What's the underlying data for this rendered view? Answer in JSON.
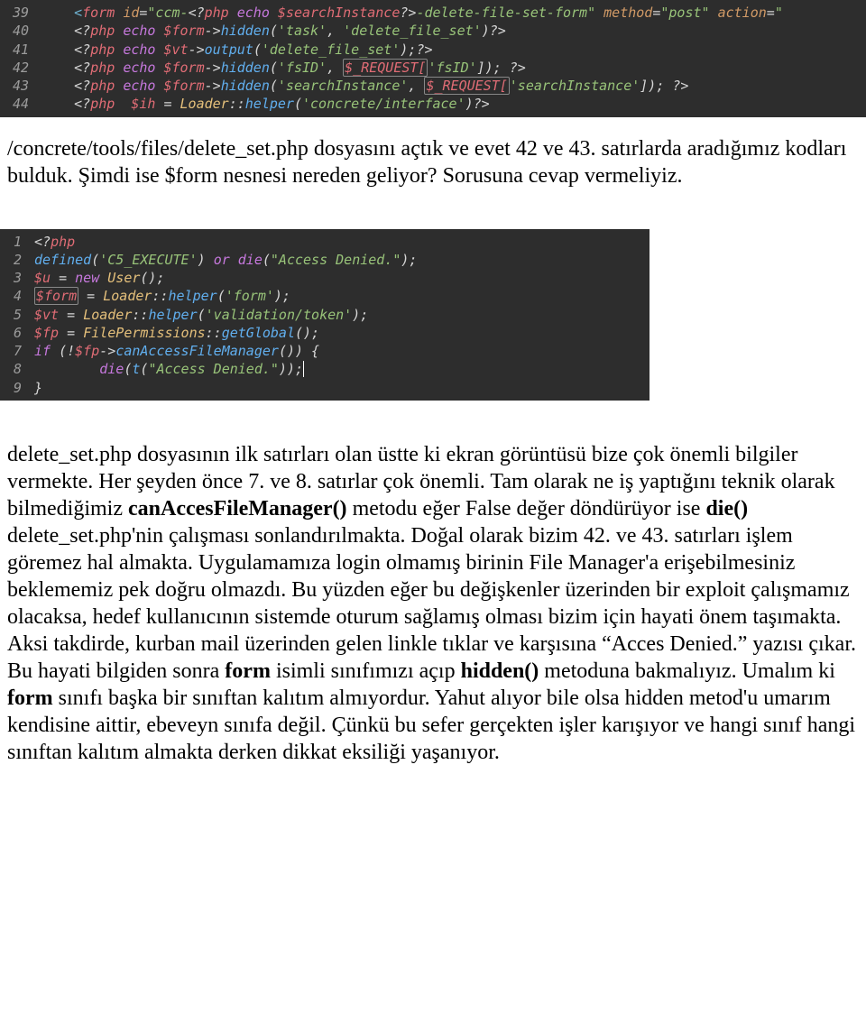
{
  "code1": {
    "lines": [
      {
        "n": "39",
        "tokens": [
          {
            "t": "    ",
            "c": "c-default"
          },
          {
            "t": "<",
            "c": "c-tag"
          },
          {
            "t": "form ",
            "c": "c-red"
          },
          {
            "t": "id",
            "c": "c-orange"
          },
          {
            "t": "=",
            "c": "c-white"
          },
          {
            "t": "\"ccm-",
            "c": "c-green"
          },
          {
            "t": "<?",
            "c": "c-default"
          },
          {
            "t": "php ",
            "c": "c-red"
          },
          {
            "t": "echo ",
            "c": "c-purple"
          },
          {
            "t": "$searchInstance",
            "c": "c-red"
          },
          {
            "t": "?>",
            "c": "c-default"
          },
          {
            "t": "-delete-file-set-form\"",
            "c": "c-green"
          },
          {
            "t": " ",
            "c": "c-default"
          },
          {
            "t": "method",
            "c": "c-orange"
          },
          {
            "t": "=",
            "c": "c-white"
          },
          {
            "t": "\"post\"",
            "c": "c-green"
          },
          {
            "t": " ",
            "c": "c-default"
          },
          {
            "t": "action",
            "c": "c-orange"
          },
          {
            "t": "=",
            "c": "c-white"
          },
          {
            "t": "\"",
            "c": "c-green"
          }
        ]
      },
      {
        "n": "40",
        "tokens": [
          {
            "t": "    ",
            "c": "c-default"
          },
          {
            "t": "<?",
            "c": "c-default"
          },
          {
            "t": "php ",
            "c": "c-red"
          },
          {
            "t": "echo ",
            "c": "c-purple"
          },
          {
            "t": "$form",
            "c": "c-red"
          },
          {
            "t": "->",
            "c": "c-white"
          },
          {
            "t": "hidden",
            "c": "c-blue"
          },
          {
            "t": "(",
            "c": "c-white"
          },
          {
            "t": "'task'",
            "c": "c-green"
          },
          {
            "t": ", ",
            "c": "c-white"
          },
          {
            "t": "'delete_file_set'",
            "c": "c-green"
          },
          {
            "t": ")",
            "c": "c-white"
          },
          {
            "t": "?>",
            "c": "c-default"
          }
        ]
      },
      {
        "n": "41",
        "tokens": [
          {
            "t": "    ",
            "c": "c-default"
          },
          {
            "t": "<?",
            "c": "c-default"
          },
          {
            "t": "php ",
            "c": "c-red"
          },
          {
            "t": "echo ",
            "c": "c-purple"
          },
          {
            "t": "$vt",
            "c": "c-red"
          },
          {
            "t": "->",
            "c": "c-white"
          },
          {
            "t": "output",
            "c": "c-blue"
          },
          {
            "t": "(",
            "c": "c-white"
          },
          {
            "t": "'delete_file_set'",
            "c": "c-green"
          },
          {
            "t": ");",
            "c": "c-white"
          },
          {
            "t": "?>",
            "c": "c-default"
          }
        ]
      },
      {
        "n": "42",
        "tokens": [
          {
            "t": "    ",
            "c": "c-default"
          },
          {
            "t": "<?",
            "c": "c-default"
          },
          {
            "t": "php ",
            "c": "c-red"
          },
          {
            "t": "echo ",
            "c": "c-purple"
          },
          {
            "t": "$form",
            "c": "c-red"
          },
          {
            "t": "->",
            "c": "c-white"
          },
          {
            "t": "hidden",
            "c": "c-blue"
          },
          {
            "t": "(",
            "c": "c-white"
          },
          {
            "t": "'fsID'",
            "c": "c-green"
          },
          {
            "t": ", ",
            "c": "c-white"
          },
          {
            "t": "$_REQUEST[",
            "c": "c-red",
            "boxed": true
          },
          {
            "t": "'fsID'",
            "c": "c-green"
          },
          {
            "t": "]); ",
            "c": "c-white"
          },
          {
            "t": "?>",
            "c": "c-default"
          }
        ]
      },
      {
        "n": "43",
        "tokens": [
          {
            "t": "    ",
            "c": "c-default"
          },
          {
            "t": "<?",
            "c": "c-default"
          },
          {
            "t": "php ",
            "c": "c-red"
          },
          {
            "t": "echo ",
            "c": "c-purple"
          },
          {
            "t": "$form",
            "c": "c-red"
          },
          {
            "t": "->",
            "c": "c-white"
          },
          {
            "t": "hidden",
            "c": "c-blue"
          },
          {
            "t": "(",
            "c": "c-white"
          },
          {
            "t": "'searchInstance'",
            "c": "c-green"
          },
          {
            "t": ", ",
            "c": "c-white"
          },
          {
            "t": "$_REQUEST[",
            "c": "c-red",
            "boxed": true
          },
          {
            "t": "'searchInstance'",
            "c": "c-green"
          },
          {
            "t": "]); ",
            "c": "c-white"
          },
          {
            "t": "?>",
            "c": "c-default"
          }
        ]
      },
      {
        "n": "44",
        "tokens": [
          {
            "t": "    ",
            "c": "c-default"
          },
          {
            "t": "<?",
            "c": "c-default"
          },
          {
            "t": "php  ",
            "c": "c-red"
          },
          {
            "t": "$ih ",
            "c": "c-red"
          },
          {
            "t": "= ",
            "c": "c-white"
          },
          {
            "t": "Loader",
            "c": "c-yellow"
          },
          {
            "t": "::",
            "c": "c-white"
          },
          {
            "t": "helper",
            "c": "c-blue"
          },
          {
            "t": "(",
            "c": "c-white"
          },
          {
            "t": "'concrete/interface'",
            "c": "c-green"
          },
          {
            "t": ")",
            "c": "c-white"
          },
          {
            "t": "?>",
            "c": "c-default"
          }
        ]
      }
    ]
  },
  "para1": "/concrete/tools/files/delete_set.php dosyasını açtık ve evet 42 ve 43. satırlarda aradığımız kodları bulduk. Şimdi ise $form nesnesi nereden geliyor? Sorusuna cevap vermeliyiz.",
  "code2": {
    "lines": [
      {
        "n": "1",
        "tokens": [
          {
            "t": "<?",
            "c": "c-default"
          },
          {
            "t": "php",
            "c": "c-red"
          }
        ]
      },
      {
        "n": "2",
        "tokens": [
          {
            "t": "defined",
            "c": "c-blue"
          },
          {
            "t": "(",
            "c": "c-white"
          },
          {
            "t": "'C5_EXECUTE'",
            "c": "c-green"
          },
          {
            "t": ") ",
            "c": "c-white"
          },
          {
            "t": "or ",
            "c": "c-purple"
          },
          {
            "t": "die",
            "c": "c-purple"
          },
          {
            "t": "(",
            "c": "c-white"
          },
          {
            "t": "\"Access Denied.\"",
            "c": "c-green"
          },
          {
            "t": ");",
            "c": "c-white"
          }
        ]
      },
      {
        "n": "3",
        "tokens": [
          {
            "t": "$u ",
            "c": "c-red"
          },
          {
            "t": "= ",
            "c": "c-white"
          },
          {
            "t": "new ",
            "c": "c-purple"
          },
          {
            "t": "User",
            "c": "c-yellow"
          },
          {
            "t": "();",
            "c": "c-white"
          }
        ]
      },
      {
        "n": "4",
        "tokens": [
          {
            "t": "$form",
            "c": "c-red",
            "boxed": true
          },
          {
            "t": " = ",
            "c": "c-white"
          },
          {
            "t": "Loader",
            "c": "c-yellow"
          },
          {
            "t": "::",
            "c": "c-white"
          },
          {
            "t": "helper",
            "c": "c-blue"
          },
          {
            "t": "(",
            "c": "c-white"
          },
          {
            "t": "'form'",
            "c": "c-green"
          },
          {
            "t": ");",
            "c": "c-white"
          }
        ]
      },
      {
        "n": "5",
        "tokens": [
          {
            "t": "$vt ",
            "c": "c-red"
          },
          {
            "t": "= ",
            "c": "c-white"
          },
          {
            "t": "Loader",
            "c": "c-yellow"
          },
          {
            "t": "::",
            "c": "c-white"
          },
          {
            "t": "helper",
            "c": "c-blue"
          },
          {
            "t": "(",
            "c": "c-white"
          },
          {
            "t": "'validation/token'",
            "c": "c-green"
          },
          {
            "t": ");",
            "c": "c-white"
          }
        ]
      },
      {
        "n": "6",
        "tokens": [
          {
            "t": "$fp ",
            "c": "c-red"
          },
          {
            "t": "= ",
            "c": "c-white"
          },
          {
            "t": "FilePermissions",
            "c": "c-yellow"
          },
          {
            "t": "::",
            "c": "c-white"
          },
          {
            "t": "getGlobal",
            "c": "c-blue"
          },
          {
            "t": "();",
            "c": "c-white"
          }
        ]
      },
      {
        "n": "7",
        "tokens": [
          {
            "t": "if ",
            "c": "c-purple"
          },
          {
            "t": "(!",
            "c": "c-white"
          },
          {
            "t": "$fp",
            "c": "c-red"
          },
          {
            "t": "->",
            "c": "c-white"
          },
          {
            "t": "canAccessFileManager",
            "c": "c-blue"
          },
          {
            "t": "()) {",
            "c": "c-white"
          }
        ]
      },
      {
        "n": "8",
        "tokens": [
          {
            "t": "        ",
            "c": "c-default"
          },
          {
            "t": "die",
            "c": "c-purple"
          },
          {
            "t": "(",
            "c": "c-white"
          },
          {
            "t": "t",
            "c": "c-blue"
          },
          {
            "t": "(",
            "c": "c-white"
          },
          {
            "t": "\"Access Denied.\"",
            "c": "c-green"
          },
          {
            "t": "));",
            "c": "c-white",
            "cursor": true
          }
        ]
      },
      {
        "n": "9",
        "tokens": [
          {
            "t": "}",
            "c": "c-white"
          }
        ]
      }
    ]
  },
  "para2": {
    "runs": [
      {
        "t": "delete_set.php dosyasının ilk satırları olan üstte ki ekran görüntüsü bize çok önemli bilgiler vermekte. Her şeyden önce 7. ve 8. satırlar çok önemli. Tam olarak ne iş yaptığını teknik olarak bilmediğimiz ",
        "b": false
      },
      {
        "t": "canAccesFileManager()",
        "b": true
      },
      {
        "t": " metodu eğer False değer döndürüyor ise ",
        "b": false
      },
      {
        "t": "die()",
        "b": true
      },
      {
        "t": " delete_set.php'nin çalışması sonlandırılmakta. Doğal olarak bizim 42. ve 43. satırları işlem göremez hal almakta. Uygulamamıza login olmamış birinin File Manager'a erişebilmesiniz beklememiz pek doğru olmazdı. Bu yüzden eğer bu değişkenler üzerinden bir exploit çalışmamız olacaksa, hedef kullanıcının sistemde oturum sağlamış olması bizim için hayati önem taşımakta. Aksi takdirde, kurban mail üzerinden gelen linkle tıklar ve karşısına “Acces Denied.” yazısı çıkar. Bu hayati bilgiden sonra ",
        "b": false
      },
      {
        "t": "form",
        "b": true
      },
      {
        "t": " isimli sınıfımızı açıp ",
        "b": false
      },
      {
        "t": "hidden()",
        "b": true
      },
      {
        "t": " metoduna bakmalıyız. Umalım ki ",
        "b": false
      },
      {
        "t": "form",
        "b": true
      },
      {
        "t": " sınıfı başka bir sınıftan kalıtım almıyordur. Yahut alıyor bile olsa hidden metod'u umarım kendisine aittir, ebeveyn sınıfa değil. Çünkü bu sefer gerçekten işler karışıyor ve hangi sınıf hangi sınıftan kalıtım almakta derken dikkat eksiliği yaşanıyor.",
        "b": false
      }
    ]
  }
}
